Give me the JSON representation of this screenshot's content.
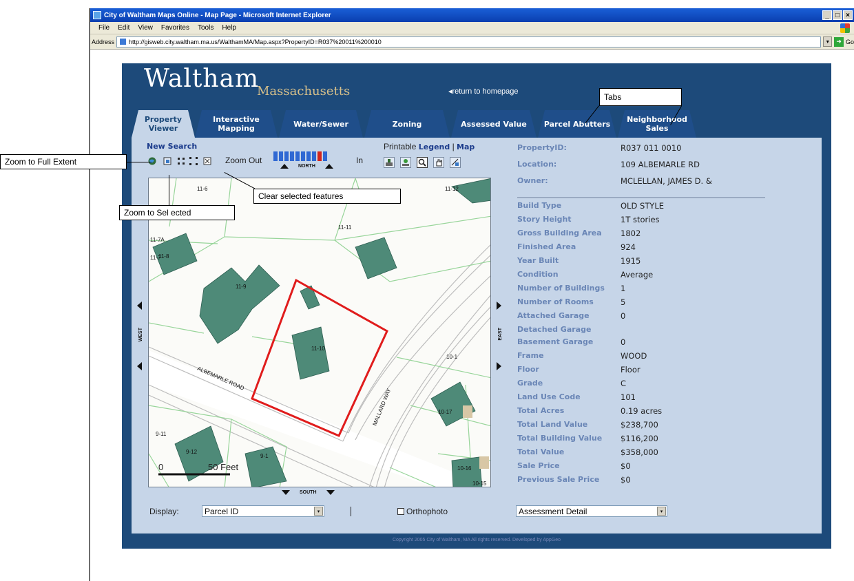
{
  "browser": {
    "title": "City of Waltham Maps Online - Map Page - Microsoft Internet Explorer",
    "menu": [
      "File",
      "Edit",
      "View",
      "Favorites",
      "Tools",
      "Help"
    ],
    "address_label": "Address",
    "url": "http://gisweb.city.waltham.ma.us/WalthamMA/Map.aspx?PropertyID=R037%20011%200010",
    "go_label": "Go",
    "window_buttons": [
      "_",
      "□",
      "×"
    ]
  },
  "site": {
    "brand": "Waltham",
    "brand_sub": "Massachusetts",
    "home_link": "◂return to homepage",
    "tabs": [
      {
        "label": "Property Viewer",
        "active": true
      },
      {
        "label": "Interactive Mapping",
        "active": false
      },
      {
        "label": "Water/Sewer",
        "active": false
      },
      {
        "label": "Zoning",
        "active": false
      },
      {
        "label": "Assessed Value",
        "active": false
      },
      {
        "label": "Parcel Abutters",
        "active": false
      },
      {
        "label": "Neighborhood Sales",
        "active": false
      }
    ],
    "new_search": "New Search",
    "zoom_out": "Zoom Out",
    "zoom_in": "In",
    "zoom_level": {
      "segments": 10,
      "current": 9
    },
    "north": "NORTH",
    "south": "SOUTH",
    "west": "WEST",
    "east": "EAST",
    "printable": "Printable",
    "legend": "Legend",
    "pipe": "|",
    "map_link": "Map",
    "map_tools": [
      "identify-icon",
      "select-icon",
      "zoom-icon",
      "pan-icon",
      "measure-icon"
    ],
    "nav_tools": [
      "full-extent-icon",
      "zoom-selected-icon",
      "previous-extent-icon",
      "next-extent-icon",
      "clear-selection-icon"
    ],
    "display_label": "Display:",
    "display_value": "Parcel ID",
    "orthophoto_label": "Orthophoto",
    "orthophoto_checked": false,
    "detail_value": "Assessment Detail",
    "copyright": "Copyright 2005 City of Waltham, MA All rights reserved. Developed by AppGeo"
  },
  "map": {
    "parcel_labels": [
      "11-6",
      "11-12",
      "11-11",
      "11-7A",
      "11-7",
      "11-8",
      "11-9",
      "11-10",
      "10-1",
      "10-17",
      "9-11",
      "9-12",
      "9-1",
      "10-16",
      "10-15"
    ],
    "street_labels": [
      "ALBEMARLE ROAD",
      "MALLARD WAY"
    ],
    "scale_start": "0",
    "scale_end": "50 Feet"
  },
  "property": {
    "header": [
      {
        "k": "PropertyID:",
        "v": "R037 011 0010"
      },
      {
        "k": "Location:",
        "v": "109 ALBEMARLE RD"
      },
      {
        "k": "Owner:",
        "v": "MCLELLAN, JAMES D. &"
      }
    ],
    "details": [
      {
        "k": "Build Type",
        "v": "OLD STYLE"
      },
      {
        "k": "Story Height",
        "v": "1T stories"
      },
      {
        "k": "Gross Building Area",
        "v": "1802"
      },
      {
        "k": "Finished Area",
        "v": "924"
      },
      {
        "k": "Year Built",
        "v": "1915"
      },
      {
        "k": "Condition",
        "v": "Average"
      },
      {
        "k": "Number of Buildings",
        "v": "1"
      },
      {
        "k": "Number of Rooms",
        "v": "5"
      },
      {
        "k": "Attached Garage",
        "v": "0"
      },
      {
        "k": "Detached Garage",
        "v": ""
      },
      {
        "k": "Basement Garage",
        "v": "0"
      },
      {
        "k": "Frame",
        "v": "WOOD"
      },
      {
        "k": "Floor",
        "v": "Floor"
      },
      {
        "k": "Grade",
        "v": "C"
      },
      {
        "k": "Land Use Code",
        "v": "101"
      },
      {
        "k": "Total Acres",
        "v": "0.19 acres"
      },
      {
        "k": "Total Land Value",
        "v": "$238,700"
      },
      {
        "k": "Total Building Value",
        "v": "$116,200"
      },
      {
        "k": "Total Value",
        "v": "$358,000"
      },
      {
        "k": "Sale Price",
        "v": "$0"
      },
      {
        "k": "Previous Sale Price",
        "v": "$0"
      }
    ]
  },
  "annotations": {
    "full_extent": "Zoom to Full Extent",
    "zoom_selected": "Zoom to Sel ected",
    "clear_selected": "Clear selected features",
    "tabs": "Tabs"
  },
  "colors": {
    "site_bg": "#1d4a7a",
    "panel_bg": "#c6d5e8",
    "tab_bg": "#1f4e8a",
    "selection": "#e01c1c",
    "building": "#4e8a78",
    "parcel_line": "#98d59a"
  }
}
